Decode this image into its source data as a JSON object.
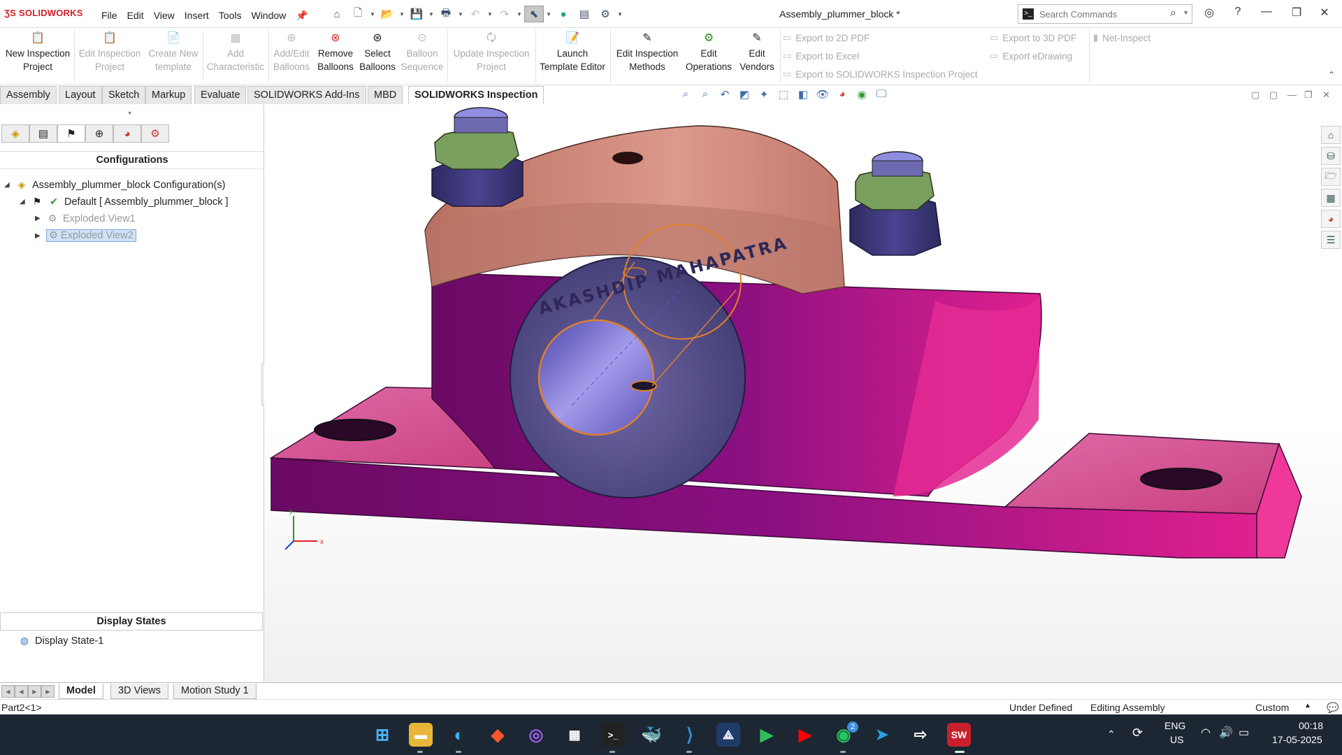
{
  "app": {
    "brand": "SOLIDWORKS",
    "menu": [
      "File",
      "Edit",
      "View",
      "Insert",
      "Tools",
      "Window"
    ],
    "document_title": "Assembly_plummer_block *",
    "search_placeholder": "Search Commands"
  },
  "command_manager": {
    "buttons": [
      {
        "label1": "New Inspection",
        "label2": "Project",
        "icon": "new-inspection-icon",
        "enabled": true
      },
      {
        "label1": "Edit Inspection",
        "label2": "Project",
        "icon": "edit-inspection-icon",
        "enabled": false
      },
      {
        "label1": "Create New",
        "label2": "template",
        "icon": "template-icon",
        "enabled": false
      },
      {
        "label1": "Add",
        "label2": "Characteristic",
        "icon": "add-characteristic-icon",
        "enabled": false
      },
      {
        "label1": "Add/Edit",
        "label2": "Balloons",
        "icon": "balloon-icon",
        "enabled": false
      },
      {
        "label1": "Remove",
        "label2": "Balloons",
        "icon": "remove-balloon-icon",
        "enabled": true
      },
      {
        "label1": "Select",
        "label2": "Balloons",
        "icon": "select-balloon-icon",
        "enabled": true
      },
      {
        "label1": "Balloon",
        "label2": "Sequence",
        "icon": "balloon-sequence-icon",
        "enabled": false
      },
      {
        "label1": "Update Inspection",
        "label2": "Project",
        "icon": "update-inspection-icon",
        "enabled": false
      },
      {
        "label1": "Launch",
        "label2": "Template Editor",
        "icon": "template-editor-icon",
        "enabled": true
      },
      {
        "label1": "Edit Inspection",
        "label2": "Methods",
        "icon": "inspection-methods-icon",
        "enabled": true
      },
      {
        "label1": "Edit",
        "label2": "Operations",
        "icon": "operations-icon",
        "enabled": true
      },
      {
        "label1": "Edit",
        "label2": "Vendors",
        "icon": "vendors-icon",
        "enabled": true
      }
    ],
    "exports": [
      "Export to 2D PDF",
      "Export to Excel",
      "Export to SOLIDWORKS Inspection Project",
      "Export to 3D PDF",
      "Export eDrawing",
      "Net-Inspect"
    ]
  },
  "tabs": [
    "Assembly",
    "Layout",
    "Sketch",
    "Markup",
    "Evaluate",
    "SOLIDWORKS Add-Ins",
    "MBD",
    "SOLIDWORKS Inspection"
  ],
  "active_tab": "SOLIDWORKS Inspection",
  "left_panel": {
    "title": "Configurations",
    "tree": {
      "root": "Assembly_plummer_block Configuration(s)",
      "default": "Default [ Assembly_plummer_block ]",
      "children": [
        "Exploded View1",
        "Exploded View2"
      ]
    },
    "display_states_title": "Display States",
    "display_state": "Display State-1"
  },
  "model": {
    "engraving": "AKASHDIP MAHAPATRA",
    "triad": {
      "x": "x",
      "y": "y"
    },
    "colors": {
      "base": "#a0188c",
      "cap": "#c88474",
      "bushing": "#5c5690",
      "nut": "#7aa060"
    }
  },
  "bottom_tabs": [
    "Model",
    "3D Views",
    "Motion Study 1"
  ],
  "status": {
    "left": "Part2<1>",
    "state": "Under Defined",
    "mode": "Editing Assembly",
    "units": "Custom"
  },
  "taskbar": {
    "lang1": "ENG",
    "lang2": "US",
    "time": "00:18",
    "date": "17-05-2025",
    "whatsapp_badge": "2",
    "sw_label": "SW"
  }
}
